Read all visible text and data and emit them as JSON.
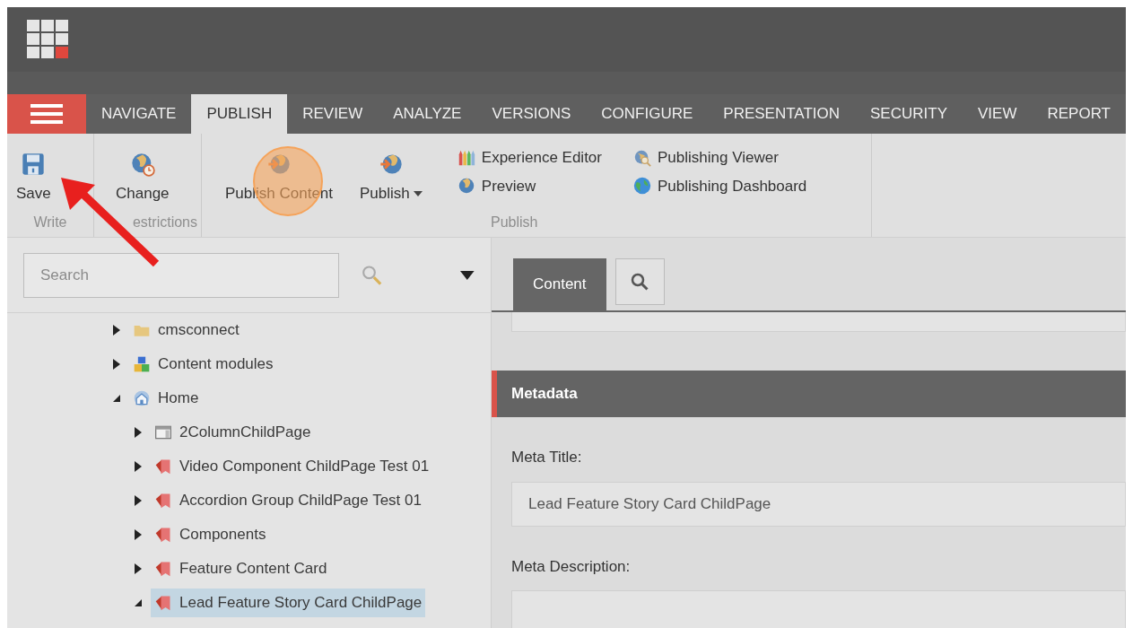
{
  "menu_tabs": [
    {
      "label": "NAVIGATE",
      "selected": false
    },
    {
      "label": "PUBLISH",
      "selected": true
    },
    {
      "label": "REVIEW",
      "selected": false
    },
    {
      "label": "ANALYZE",
      "selected": false
    },
    {
      "label": "VERSIONS",
      "selected": false
    },
    {
      "label": "CONFIGURE",
      "selected": false
    },
    {
      "label": "PRESENTATION",
      "selected": false
    },
    {
      "label": "SECURITY",
      "selected": false
    },
    {
      "label": "VIEW",
      "selected": false
    },
    {
      "label": "REPORT",
      "selected": false
    }
  ],
  "ribbon": {
    "groups": [
      {
        "label": "Write",
        "large": [
          {
            "label": "Save",
            "kind": "save",
            "dropdown": false
          }
        ]
      },
      {
        "label": "estrictions",
        "large": [
          {
            "label": "Change",
            "kind": "globe-clock",
            "dropdown": false
          }
        ]
      },
      {
        "label": "Publish",
        "large": [
          {
            "label": "Publish Content",
            "kind": "globe-arrow",
            "dropdown": false
          },
          {
            "label": "Publish",
            "kind": "globe-arrow",
            "dropdown": true
          }
        ],
        "small": [
          [
            {
              "label": "Experience Editor",
              "kind": "crayons"
            },
            {
              "label": "Preview",
              "kind": "globe"
            }
          ],
          [
            {
              "label": "Publishing Viewer",
              "kind": "globe-search"
            },
            {
              "label": "Publishing Dashboard",
              "kind": "earth"
            }
          ]
        ]
      }
    ]
  },
  "search": {
    "placeholder": "Search"
  },
  "tree": [
    {
      "label": "cmsconnect",
      "kind": "folder",
      "expanded": false,
      "selected": false
    },
    {
      "label": "Content modules",
      "kind": "modules",
      "expanded": false,
      "selected": false
    },
    {
      "label": "Home",
      "kind": "home",
      "expanded": true,
      "selected": false,
      "children": [
        {
          "label": "2ColumnChildPage",
          "kind": "template",
          "expanded": false,
          "selected": false
        },
        {
          "label": "Video Component ChildPage Test 01",
          "kind": "page",
          "expanded": false,
          "selected": false
        },
        {
          "label": "Accordion Group ChildPage Test 01",
          "kind": "page",
          "expanded": false,
          "selected": false
        },
        {
          "label": "Components",
          "kind": "page",
          "expanded": false,
          "selected": false
        },
        {
          "label": "Feature Content Card",
          "kind": "page",
          "expanded": false,
          "selected": false
        },
        {
          "label": "Lead Feature Story Card ChildPage",
          "kind": "page",
          "expanded": true,
          "selected": true
        }
      ]
    }
  ],
  "editor_tabs": [
    {
      "kind": "text",
      "label": "Content",
      "selected": true
    },
    {
      "kind": "search",
      "selected": false
    }
  ],
  "section": {
    "title": "Metadata"
  },
  "fields": [
    {
      "label": "Meta Title:",
      "value": "Lead Feature Story Card ChildPage"
    },
    {
      "label": "Meta Description:"
    }
  ]
}
